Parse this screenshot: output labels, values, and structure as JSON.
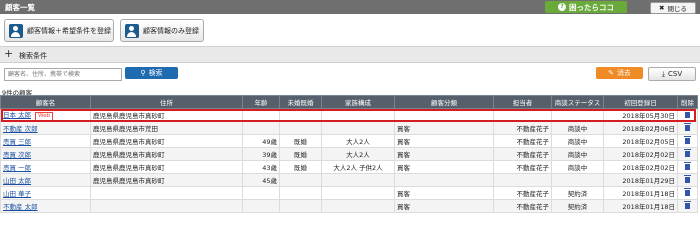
{
  "window": {
    "title": "顧客一覧",
    "help_label": "困ったらココ",
    "close_label": "閉じる"
  },
  "register": {
    "btn1_label": "顧客情報＋希望条件を登録",
    "btn2_label": "顧客情報のみ登録"
  },
  "conditions": {
    "label": "検索条件"
  },
  "search": {
    "placeholder": "顧客名、住所、携帯で検索",
    "button_label": "検索",
    "clear_label": "消去",
    "csv_label": "CSV"
  },
  "results": {
    "count_text": "9件の顧客"
  },
  "table": {
    "headers": [
      "顧客名",
      "住所",
      "年齢",
      "未婚既婚",
      "家族構成",
      "顧客分類",
      "担当者",
      "商談ステータス",
      "初回登録日",
      "削除"
    ],
    "rows": [
      {
        "name": "日本 太郎",
        "web": "Web",
        "address": "鹿児島県鹿児島市真砂町",
        "age": "",
        "marital": "",
        "family": "",
        "category": "",
        "staff": "",
        "status": "",
        "date": "2018年05月30日"
      },
      {
        "name": "不動産 次郎",
        "web": "",
        "address": "鹿児島県鹿児島市荒田",
        "age": "",
        "marital": "",
        "family": "",
        "category": "買客",
        "staff": "不動産花子",
        "status": "商談中",
        "date": "2018年02月06日"
      },
      {
        "name": "売買 三郎",
        "web": "",
        "address": "鹿児島県鹿児島市真砂町",
        "age": "49歳",
        "marital": "既婚",
        "family": "大人2人",
        "category": "買客",
        "staff": "不動産花子",
        "status": "商談中",
        "date": "2018年02月05日"
      },
      {
        "name": "売買 次郎",
        "web": "",
        "address": "鹿児島県鹿児島市真砂町",
        "age": "39歳",
        "marital": "既婚",
        "family": "大人2人",
        "category": "買客",
        "staff": "不動産花子",
        "status": "商談中",
        "date": "2018年02月02日"
      },
      {
        "name": "売買 一郎",
        "web": "",
        "address": "鹿児島県鹿児島市真砂町",
        "age": "43歳",
        "marital": "既婚",
        "family": "大人2人 子供2人",
        "category": "買客",
        "staff": "不動産花子",
        "status": "商談中",
        "date": "2018年02月02日"
      },
      {
        "name": "山田 太郎",
        "web": "",
        "address": "鹿児島県鹿児島市真砂町",
        "age": "45歳",
        "marital": "",
        "family": "",
        "category": "",
        "staff": "",
        "status": "",
        "date": "2018年01月29日"
      },
      {
        "name": "山田 華子",
        "web": "",
        "address": "",
        "age": "",
        "marital": "",
        "family": "",
        "category": "買客",
        "staff": "不動産花子",
        "status": "契約済",
        "date": "2018年01月18日"
      },
      {
        "name": "不動産 太郎",
        "web": "",
        "address": "",
        "age": "",
        "marital": "",
        "family": "",
        "category": "買客",
        "staff": "不動産花子",
        "status": "契約済",
        "date": "2018年01月18日"
      }
    ]
  }
}
